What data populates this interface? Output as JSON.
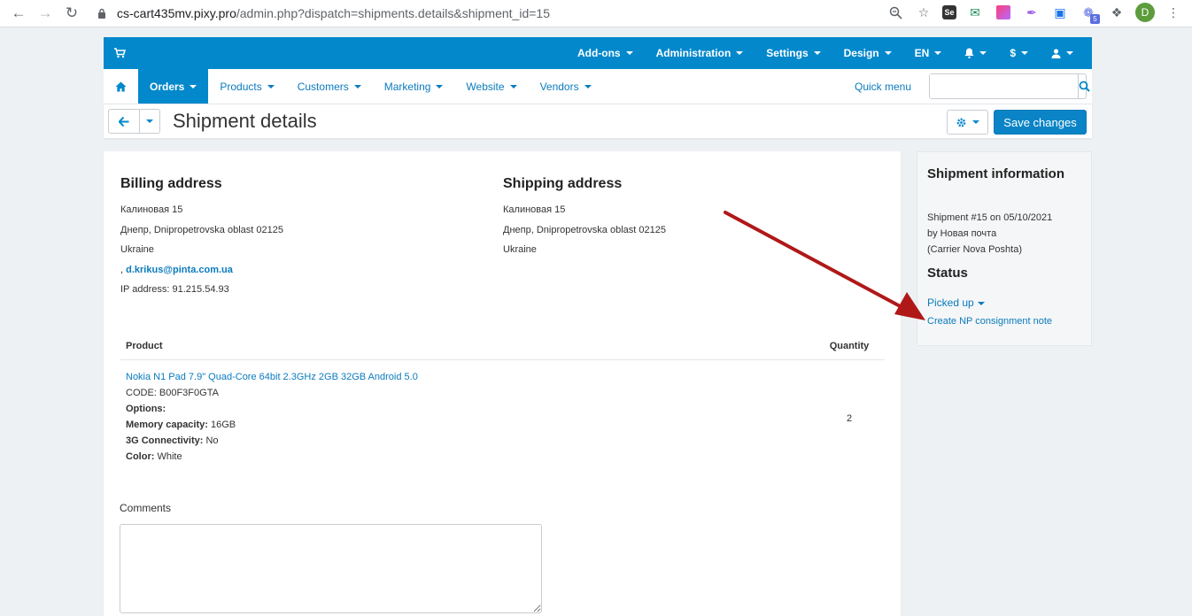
{
  "browser": {
    "url_host": "cs-cart435mv.pixy.pro",
    "url_path": "/admin.php?dispatch=shipments.details&shipment_id=15",
    "ext_se": "Se",
    "ext_badge": "5",
    "profile_initial": "D"
  },
  "topbar": {
    "items": [
      {
        "label": "Add-ons"
      },
      {
        "label": "Administration"
      },
      {
        "label": "Settings"
      },
      {
        "label": "Design"
      },
      {
        "label": "EN"
      },
      {
        "label": "$"
      }
    ]
  },
  "subnav": {
    "items": [
      {
        "label": "Orders"
      },
      {
        "label": "Products"
      },
      {
        "label": "Customers"
      },
      {
        "label": "Marketing"
      },
      {
        "label": "Website"
      },
      {
        "label": "Vendors"
      }
    ],
    "quick_menu": "Quick menu",
    "search_placeholder": ""
  },
  "titlebar": {
    "title": "Shipment details",
    "save_label": "Save changes"
  },
  "billing": {
    "heading": "Billing address",
    "line1": "Калиновая 15",
    "line2": "Днепр, Dnipropetrovska oblast 02125",
    "line3": "Ukraine",
    "email_prefix": ", ",
    "email": "d.krikus@pinta.com.ua",
    "ip": "IP address: 91.215.54.93"
  },
  "shipping": {
    "heading": "Shipping address",
    "line1": "Калиновая 15",
    "line2": "Днепр, Dnipropetrovska oblast 02125",
    "line3": "Ukraine"
  },
  "products": {
    "col_product": "Product",
    "col_quantity": "Quantity",
    "rows": [
      {
        "name": "Nokia N1 Pad 7.9\" Quad-Core 64bit 2.3GHz 2GB 32GB Android 5.0",
        "code": "CODE: B00F3F0GTA",
        "options_label": "Options:",
        "opt1_label": "Memory capacity:",
        "opt1_value": " 16GB",
        "opt2_label": "3G Connectivity:",
        "opt2_value": " No",
        "opt3_label": "Color:",
        "opt3_value": " White",
        "quantity": "2"
      }
    ]
  },
  "comments": {
    "label": "Comments",
    "value": ""
  },
  "sidebar": {
    "info_heading": "Shipment information",
    "info_line1": "Shipment #15 on 05/10/2021",
    "info_line2": "by Новая почта",
    "info_line3": "(Carrier Nova Poshta)",
    "status_heading": "Status",
    "status_value": "Picked up",
    "np_link": "Create NP consignment note"
  },
  "colors": {
    "primary": "#0388cc",
    "link": "#0a7bbd",
    "annotation_arrow": "#b01818"
  }
}
